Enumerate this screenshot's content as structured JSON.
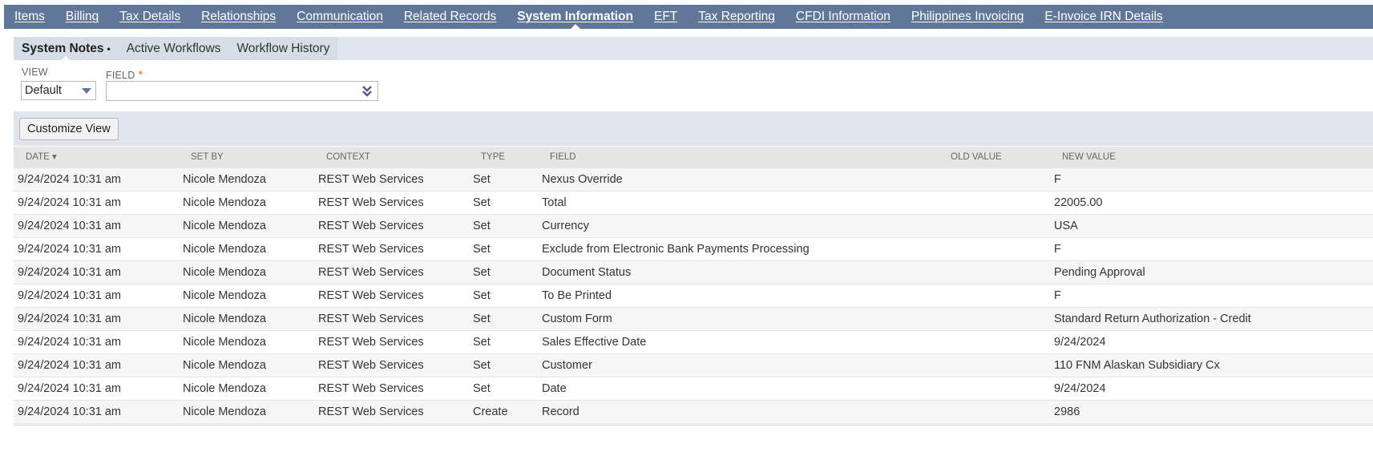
{
  "top_tabs": [
    {
      "label": "Items",
      "active": false
    },
    {
      "label": "Billing",
      "active": false
    },
    {
      "label": "Tax Details",
      "active": false
    },
    {
      "label": "Relationships",
      "active": false
    },
    {
      "label": "Communication",
      "active": false
    },
    {
      "label": "Related Records",
      "active": false
    },
    {
      "label": "System Information",
      "active": true
    },
    {
      "label": "EFT",
      "active": false
    },
    {
      "label": "Tax Reporting",
      "active": false
    },
    {
      "label": "CFDI Information",
      "active": false
    },
    {
      "label": "Philippines Invoicing",
      "active": false
    },
    {
      "label": "E-Invoice IRN Details",
      "active": false
    }
  ],
  "sub_tabs": [
    {
      "label": "System Notes",
      "active": true,
      "marker": "•"
    },
    {
      "label": "Active Workflows",
      "active": false
    },
    {
      "label": "Workflow History",
      "active": false
    }
  ],
  "filters": {
    "view_label": "VIEW",
    "view_value": "Default",
    "field_label": "FIELD",
    "field_required_mark": "*",
    "field_value": ""
  },
  "toolbar": {
    "customize_label": "Customize View"
  },
  "table": {
    "columns": {
      "date": "DATE ▾",
      "set_by": "SET BY",
      "context": "CONTEXT",
      "type": "TYPE",
      "field": "FIELD",
      "old_value": "OLD VALUE",
      "new_value": "NEW VALUE"
    },
    "rows": [
      {
        "date": "9/24/2024 10:31 am",
        "set_by": "Nicole Mendoza",
        "context": "REST Web Services",
        "type": "Set",
        "field": "Nexus Override",
        "old_value": "",
        "new_value": "F"
      },
      {
        "date": "9/24/2024 10:31 am",
        "set_by": "Nicole Mendoza",
        "context": "REST Web Services",
        "type": "Set",
        "field": "Total",
        "old_value": "",
        "new_value": "22005.00"
      },
      {
        "date": "9/24/2024 10:31 am",
        "set_by": "Nicole Mendoza",
        "context": "REST Web Services",
        "type": "Set",
        "field": "Currency",
        "old_value": "",
        "new_value": "USA"
      },
      {
        "date": "9/24/2024 10:31 am",
        "set_by": "Nicole Mendoza",
        "context": "REST Web Services",
        "type": "Set",
        "field": "Exclude from Electronic Bank Payments Processing",
        "old_value": "",
        "new_value": "F"
      },
      {
        "date": "9/24/2024 10:31 am",
        "set_by": "Nicole Mendoza",
        "context": "REST Web Services",
        "type": "Set",
        "field": "Document Status",
        "old_value": "",
        "new_value": "Pending Approval"
      },
      {
        "date": "9/24/2024 10:31 am",
        "set_by": "Nicole Mendoza",
        "context": "REST Web Services",
        "type": "Set",
        "field": "To Be Printed",
        "old_value": "",
        "new_value": "F"
      },
      {
        "date": "9/24/2024 10:31 am",
        "set_by": "Nicole Mendoza",
        "context": "REST Web Services",
        "type": "Set",
        "field": "Custom Form",
        "old_value": "",
        "new_value": "Standard Return Authorization - Credit"
      },
      {
        "date": "9/24/2024 10:31 am",
        "set_by": "Nicole Mendoza",
        "context": "REST Web Services",
        "type": "Set",
        "field": "Sales Effective Date",
        "old_value": "",
        "new_value": "9/24/2024"
      },
      {
        "date": "9/24/2024 10:31 am",
        "set_by": "Nicole Mendoza",
        "context": "REST Web Services",
        "type": "Set",
        "field": "Customer",
        "old_value": "",
        "new_value": "110 FNM Alaskan Subsidiary Cx"
      },
      {
        "date": "9/24/2024 10:31 am",
        "set_by": "Nicole Mendoza",
        "context": "REST Web Services",
        "type": "Set",
        "field": "Date",
        "old_value": "",
        "new_value": "9/24/2024"
      },
      {
        "date": "9/24/2024 10:31 am",
        "set_by": "Nicole Mendoza",
        "context": "REST Web Services",
        "type": "Create",
        "field": "Record",
        "old_value": "",
        "new_value": "2986"
      }
    ]
  }
}
